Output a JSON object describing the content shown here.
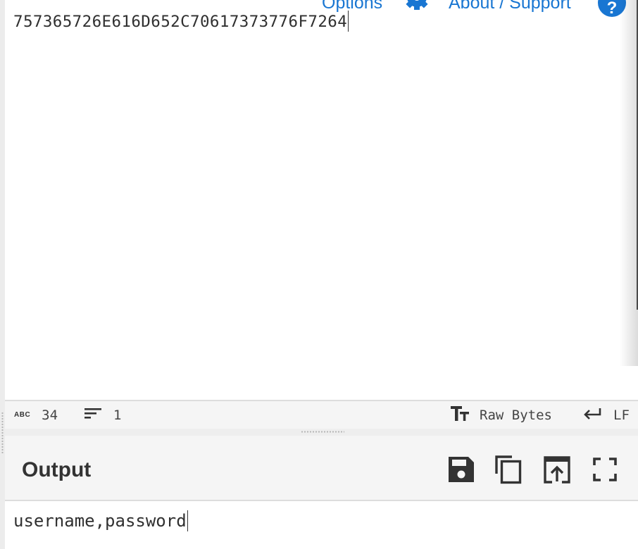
{
  "top_links": {
    "options_label": "Options",
    "about_label": "About / Support",
    "help_glyph": "?"
  },
  "input": {
    "value": "757365726E616D652C70617373776F7264"
  },
  "status_bar": {
    "length_icon": "ABC",
    "length_value": "34",
    "lines_icon": "lines-icon",
    "lines_value": "1",
    "format_icon": "text-format-icon",
    "format_label": "Raw Bytes",
    "eol_icon": "return-arrow-icon",
    "eol_label": "LF"
  },
  "output": {
    "title": "Output",
    "value": "username,password",
    "actions": [
      "save-icon",
      "copy-icon",
      "open-in-input-icon",
      "fullscreen-icon"
    ]
  },
  "colors": {
    "accent": "#1976d2",
    "text": "#303030",
    "panel": "#f5f5f5",
    "border": "#dddddd"
  }
}
